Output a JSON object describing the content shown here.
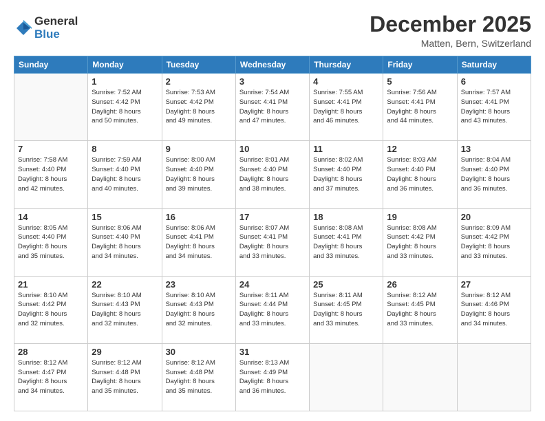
{
  "header": {
    "logo_general": "General",
    "logo_blue": "Blue",
    "month_title": "December 2025",
    "location": "Matten, Bern, Switzerland"
  },
  "days_of_week": [
    "Sunday",
    "Monday",
    "Tuesday",
    "Wednesday",
    "Thursday",
    "Friday",
    "Saturday"
  ],
  "weeks": [
    [
      {
        "day": "",
        "info": ""
      },
      {
        "day": "1",
        "info": "Sunrise: 7:52 AM\nSunset: 4:42 PM\nDaylight: 8 hours\nand 50 minutes."
      },
      {
        "day": "2",
        "info": "Sunrise: 7:53 AM\nSunset: 4:42 PM\nDaylight: 8 hours\nand 49 minutes."
      },
      {
        "day": "3",
        "info": "Sunrise: 7:54 AM\nSunset: 4:41 PM\nDaylight: 8 hours\nand 47 minutes."
      },
      {
        "day": "4",
        "info": "Sunrise: 7:55 AM\nSunset: 4:41 PM\nDaylight: 8 hours\nand 46 minutes."
      },
      {
        "day": "5",
        "info": "Sunrise: 7:56 AM\nSunset: 4:41 PM\nDaylight: 8 hours\nand 44 minutes."
      },
      {
        "day": "6",
        "info": "Sunrise: 7:57 AM\nSunset: 4:41 PM\nDaylight: 8 hours\nand 43 minutes."
      }
    ],
    [
      {
        "day": "7",
        "info": "Sunrise: 7:58 AM\nSunset: 4:40 PM\nDaylight: 8 hours\nand 42 minutes."
      },
      {
        "day": "8",
        "info": "Sunrise: 7:59 AM\nSunset: 4:40 PM\nDaylight: 8 hours\nand 40 minutes."
      },
      {
        "day": "9",
        "info": "Sunrise: 8:00 AM\nSunset: 4:40 PM\nDaylight: 8 hours\nand 39 minutes."
      },
      {
        "day": "10",
        "info": "Sunrise: 8:01 AM\nSunset: 4:40 PM\nDaylight: 8 hours\nand 38 minutes."
      },
      {
        "day": "11",
        "info": "Sunrise: 8:02 AM\nSunset: 4:40 PM\nDaylight: 8 hours\nand 37 minutes."
      },
      {
        "day": "12",
        "info": "Sunrise: 8:03 AM\nSunset: 4:40 PM\nDaylight: 8 hours\nand 36 minutes."
      },
      {
        "day": "13",
        "info": "Sunrise: 8:04 AM\nSunset: 4:40 PM\nDaylight: 8 hours\nand 36 minutes."
      }
    ],
    [
      {
        "day": "14",
        "info": "Sunrise: 8:05 AM\nSunset: 4:40 PM\nDaylight: 8 hours\nand 35 minutes."
      },
      {
        "day": "15",
        "info": "Sunrise: 8:06 AM\nSunset: 4:40 PM\nDaylight: 8 hours\nand 34 minutes."
      },
      {
        "day": "16",
        "info": "Sunrise: 8:06 AM\nSunset: 4:41 PM\nDaylight: 8 hours\nand 34 minutes."
      },
      {
        "day": "17",
        "info": "Sunrise: 8:07 AM\nSunset: 4:41 PM\nDaylight: 8 hours\nand 33 minutes."
      },
      {
        "day": "18",
        "info": "Sunrise: 8:08 AM\nSunset: 4:41 PM\nDaylight: 8 hours\nand 33 minutes."
      },
      {
        "day": "19",
        "info": "Sunrise: 8:08 AM\nSunset: 4:42 PM\nDaylight: 8 hours\nand 33 minutes."
      },
      {
        "day": "20",
        "info": "Sunrise: 8:09 AM\nSunset: 4:42 PM\nDaylight: 8 hours\nand 33 minutes."
      }
    ],
    [
      {
        "day": "21",
        "info": "Sunrise: 8:10 AM\nSunset: 4:42 PM\nDaylight: 8 hours\nand 32 minutes."
      },
      {
        "day": "22",
        "info": "Sunrise: 8:10 AM\nSunset: 4:43 PM\nDaylight: 8 hours\nand 32 minutes."
      },
      {
        "day": "23",
        "info": "Sunrise: 8:10 AM\nSunset: 4:43 PM\nDaylight: 8 hours\nand 32 minutes."
      },
      {
        "day": "24",
        "info": "Sunrise: 8:11 AM\nSunset: 4:44 PM\nDaylight: 8 hours\nand 33 minutes."
      },
      {
        "day": "25",
        "info": "Sunrise: 8:11 AM\nSunset: 4:45 PM\nDaylight: 8 hours\nand 33 minutes."
      },
      {
        "day": "26",
        "info": "Sunrise: 8:12 AM\nSunset: 4:45 PM\nDaylight: 8 hours\nand 33 minutes."
      },
      {
        "day": "27",
        "info": "Sunrise: 8:12 AM\nSunset: 4:46 PM\nDaylight: 8 hours\nand 34 minutes."
      }
    ],
    [
      {
        "day": "28",
        "info": "Sunrise: 8:12 AM\nSunset: 4:47 PM\nDaylight: 8 hours\nand 34 minutes."
      },
      {
        "day": "29",
        "info": "Sunrise: 8:12 AM\nSunset: 4:48 PM\nDaylight: 8 hours\nand 35 minutes."
      },
      {
        "day": "30",
        "info": "Sunrise: 8:12 AM\nSunset: 4:48 PM\nDaylight: 8 hours\nand 35 minutes."
      },
      {
        "day": "31",
        "info": "Sunrise: 8:13 AM\nSunset: 4:49 PM\nDaylight: 8 hours\nand 36 minutes."
      },
      {
        "day": "",
        "info": ""
      },
      {
        "day": "",
        "info": ""
      },
      {
        "day": "",
        "info": ""
      }
    ]
  ]
}
